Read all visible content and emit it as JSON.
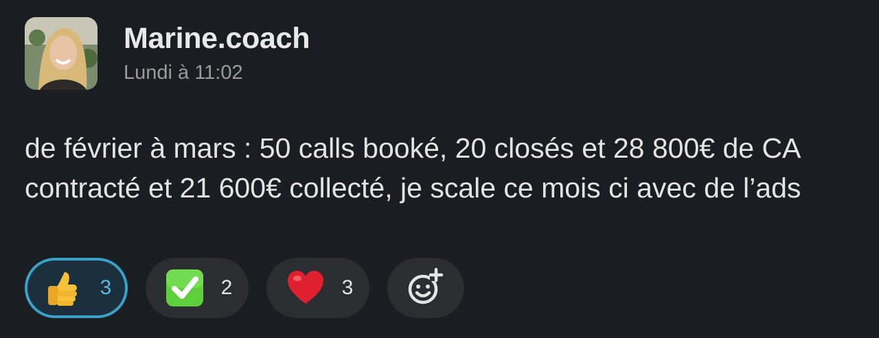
{
  "message": {
    "author": "Marine.coach",
    "timestamp": "Lundi à 11:02",
    "text": "de février à mars : 50 calls booké, 20 closés et 28 800€ de CA contracté et 21 600€  collecté, je scale ce mois ci avec de l’ads"
  },
  "reactions": [
    {
      "emoji": "thumbs-up-icon",
      "count": "3",
      "active": true
    },
    {
      "emoji": "check-mark-button-icon",
      "count": "2",
      "active": false
    },
    {
      "emoji": "red-heart-icon",
      "count": "3",
      "active": false
    }
  ],
  "add_reaction": {
    "icon": "add-reaction-icon"
  },
  "colors": {
    "background": "#1a1d21",
    "active_reaction_border": "#3aa1c9",
    "active_reaction_count": "#59b8e0",
    "reaction_pill": "#2b2d31"
  }
}
